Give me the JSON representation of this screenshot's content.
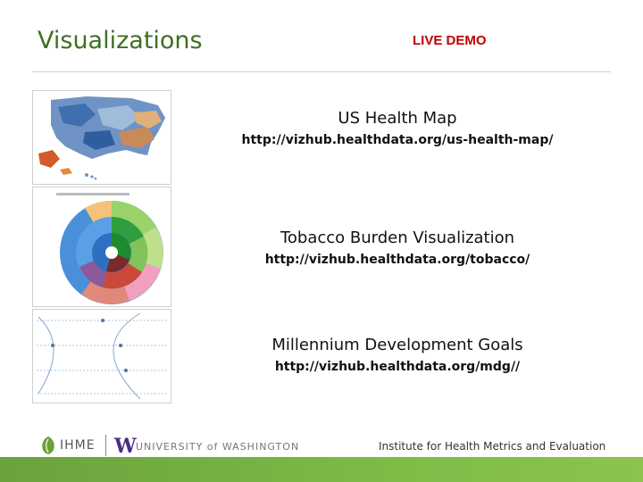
{
  "header": {
    "title": "Visualizations",
    "live_demo": "LIVE DEMO"
  },
  "items": [
    {
      "title": "US Health Map",
      "url": "http://vizhub.healthdata.org/us-health-map/"
    },
    {
      "title": "Tobacco Burden Visualization",
      "url": "http://vizhub.healthdata.org/tobacco/"
    },
    {
      "title": "Millennium Development Goals",
      "url": "http://vizhub.healthdata.org/mdg//"
    }
  ],
  "footer": {
    "ihme_logo_text": "IHME",
    "uw_logo_text": "UNIVERSITY of WASHINGTON",
    "institute_text": "Institute for Health Metrics and Evaluation"
  },
  "colors": {
    "title_green": "#3f6f22",
    "live_red": "#c00000",
    "band_green": "#7dbb47",
    "uw_purple": "#4b2e83"
  }
}
